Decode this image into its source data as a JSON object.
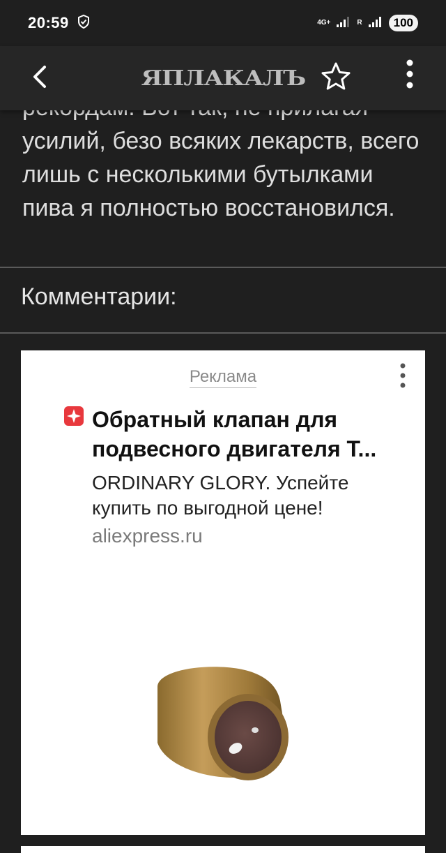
{
  "status": {
    "time": "20:59",
    "network": "4G+",
    "roaming": "R",
    "battery": "100"
  },
  "app_bar": {
    "logo": "ЯПЛАКАЛЪ",
    "icons": [
      "back-arrow-icon",
      "star-icon",
      "more-vertical-icon"
    ]
  },
  "article": {
    "text": "рекордам. Вот так, не прилагая усилий, безо всяких лекарств, всего лишь с несколькими бутылками пива я полностью восстановился."
  },
  "comments": {
    "title": "Комментарии:"
  },
  "ad": {
    "label": "Реклама",
    "title": "Обратный клапан для подвесного двигателя T...",
    "description": "ORDINARY GLORY. Успейте купить по выгодной цене!",
    "domain": "aliexpress.ru",
    "brand_color": "#e8383d"
  }
}
